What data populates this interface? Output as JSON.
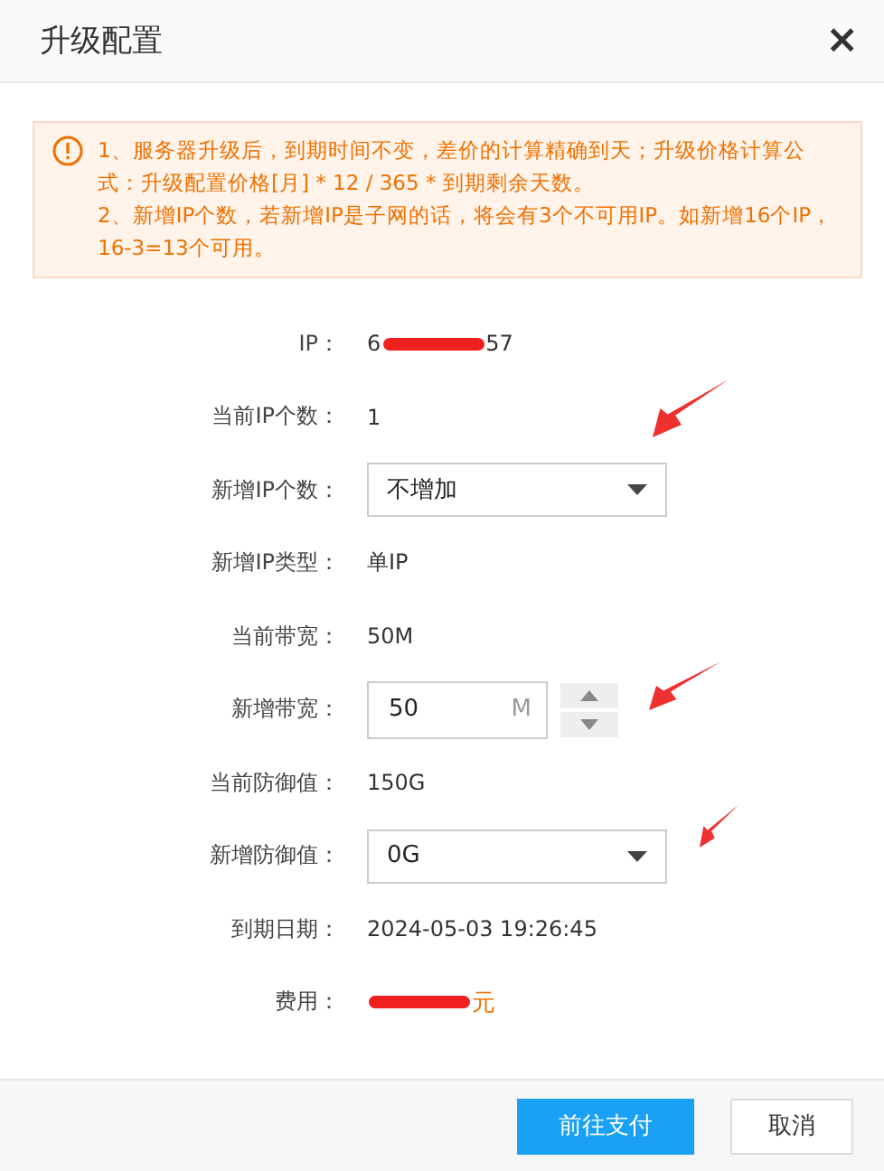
{
  "window": {
    "title": "升级配置",
    "close": "×"
  },
  "notice": {
    "lines": [
      "1、服务器升级后，到期时间不变，差价的计算精确到天；升级价格计算公式：升级配置价格[月] * 12 / 365 * 到期剩余天数。",
      "2、新增IP个数，若新增IP是子网的话，将会有3个不可用IP。如新增16个IP，16-3=13个可用。"
    ]
  },
  "rows": [
    {
      "kind": "redacted",
      "label": "IP：",
      "parts": [
        "6",
        "57"
      ]
    },
    {
      "kind": "text",
      "label": "当前IP个数：",
      "value": "1"
    },
    {
      "kind": "select",
      "label": "新增IP个数：",
      "value": "不增加"
    },
    {
      "kind": "text",
      "label": "新增IP类型：",
      "value": "单IP"
    },
    {
      "kind": "text",
      "label": "当前带宽：",
      "value": "50M"
    },
    {
      "kind": "number",
      "label": "新增带宽：",
      "value": "50",
      "unit": "M"
    },
    {
      "kind": "text",
      "label": "当前防御值：",
      "value": "150G"
    },
    {
      "kind": "select",
      "label": "新增防御值：",
      "value": "0G"
    },
    {
      "kind": "text",
      "label": "到期日期：",
      "value": "2024-05-03 19:26:45"
    },
    {
      "kind": "price",
      "label": "费用：",
      "unit": "元"
    }
  ],
  "buttons": [
    {
      "label": "前往支付",
      "kind": "primary"
    },
    {
      "label": "取消",
      "kind": "default"
    }
  ]
}
